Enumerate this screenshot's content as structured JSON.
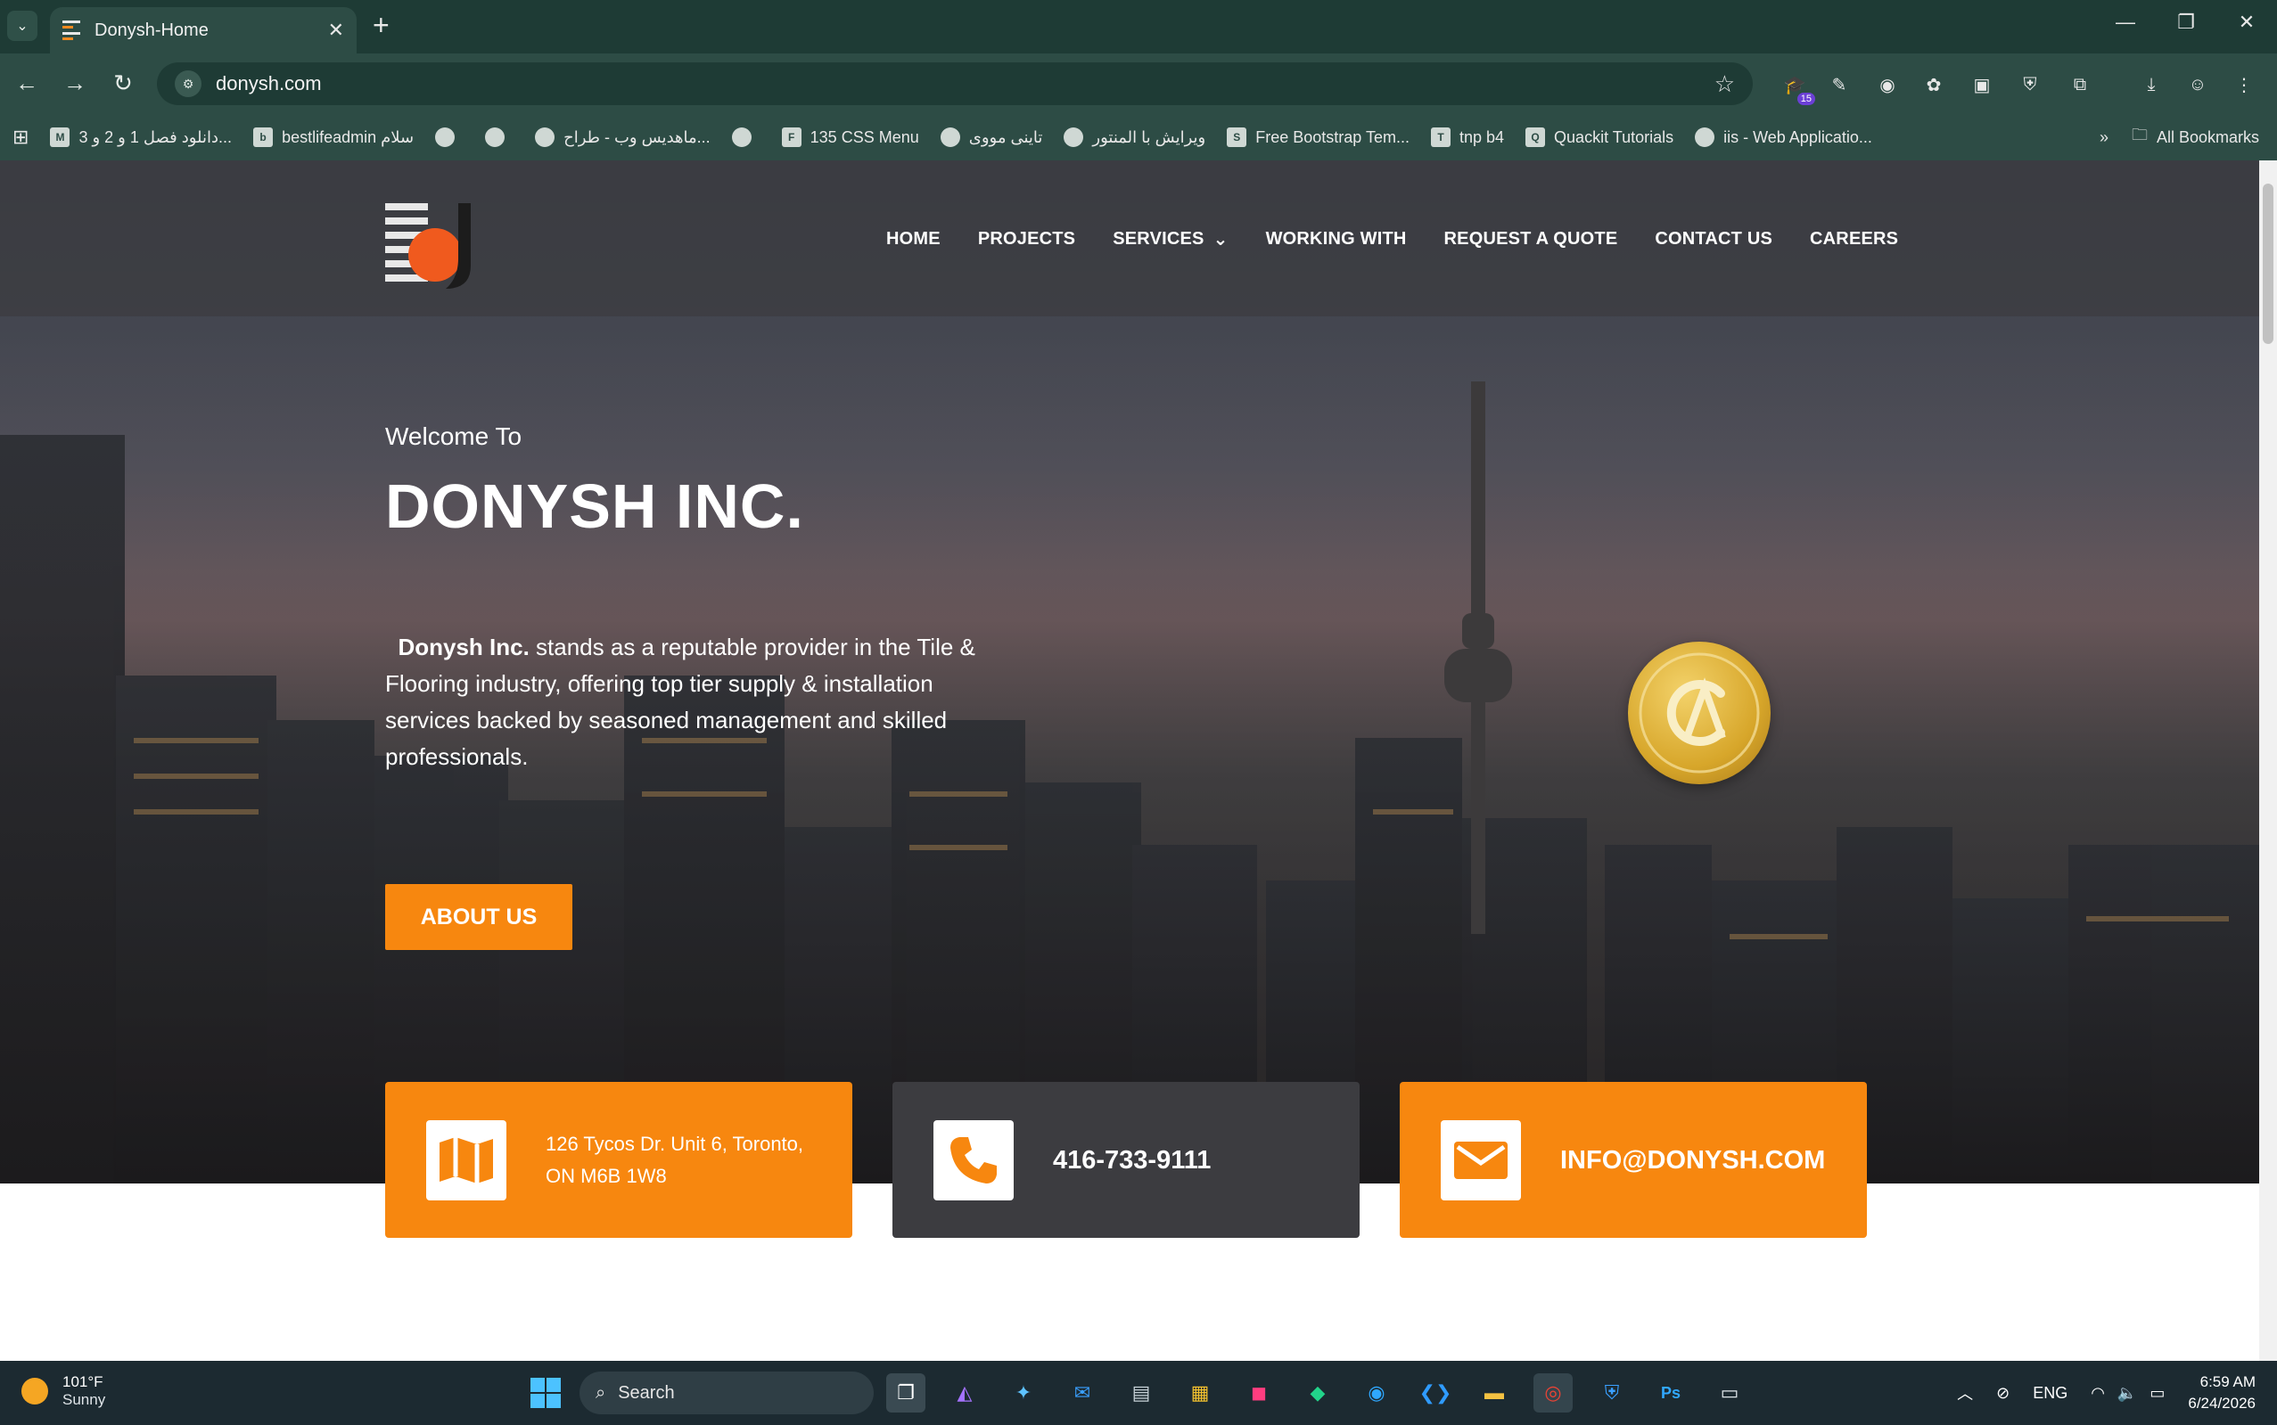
{
  "browser": {
    "tab_title": "Donysh-Home",
    "url": "donysh.com",
    "extension_badge": "15",
    "bookmarks": [
      {
        "icon": "M",
        "label": "دانلود فصل 1 و 2 و 3..."
      },
      {
        "icon": "b",
        "label": "bestlifeadmin سلام"
      },
      {
        "icon": "",
        "label": ""
      },
      {
        "icon": "",
        "label": ""
      },
      {
        "icon": "",
        "label": "ماهدیس وب - طراح..."
      },
      {
        "icon": "",
        "label": ""
      },
      {
        "icon": "F",
        "label": "135 CSS Menu"
      },
      {
        "icon": "",
        "label": "تاینی مووی"
      },
      {
        "icon": "",
        "label": "ویرایش با المنتور"
      },
      {
        "icon": "S",
        "label": "Free Bootstrap Tem..."
      },
      {
        "icon": "T",
        "label": "tnp b4"
      },
      {
        "icon": "Q",
        "label": "Quackit Tutorials"
      },
      {
        "icon": "",
        "label": "iis - Web Applicatio..."
      }
    ],
    "all_bookmarks": "All Bookmarks"
  },
  "site": {
    "nav": [
      "HOME",
      "PROJECTS",
      "SERVICES",
      "WORKING WITH",
      "REQUEST A QUOTE",
      "CONTACT US",
      "CAREERS"
    ],
    "welcome": "Welcome To",
    "brand": "DONYSH INC.",
    "lead_bold": "Donysh Inc.",
    "lead_rest": " stands as a reputable provider in the Tile & Flooring industry, offering top tier supply & installation services backed by seasoned management and skilled professionals.",
    "cta": "ABOUT US",
    "address": "126 Tycos Dr. Unit 6, Toronto, ON M6B 1W8",
    "phone": "416-733-9111",
    "email": "INFO@DONYSH.COM",
    "colors": {
      "accent": "#f7870f",
      "dark_card": "#3c3c40"
    }
  },
  "taskbar": {
    "temp": "101°F",
    "condition": "Sunny",
    "search": "Search",
    "lang": "ENG",
    "time": "6:59 AM",
    "date": "6/24/2026"
  }
}
